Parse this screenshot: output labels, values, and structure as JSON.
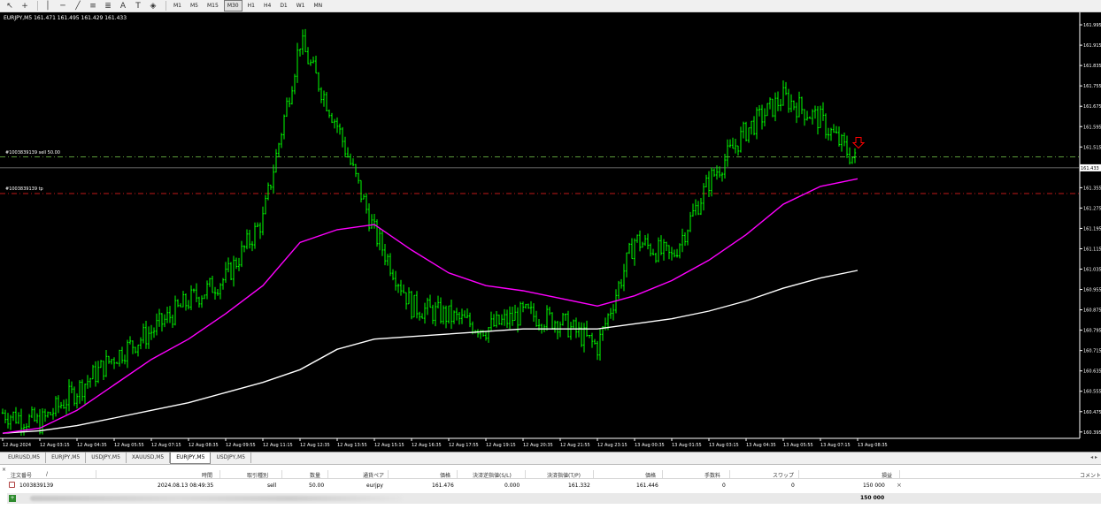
{
  "toolbar": {
    "tool_icons": [
      "cursor-icon",
      "crosshair-icon",
      "vertical-line-icon",
      "horizontal-line-icon",
      "trendline-icon",
      "channel-icon",
      "fibonacci-icon",
      "text-icon",
      "label-icon",
      "shapes-icon"
    ],
    "text_tool": "A",
    "timeframes": [
      "M1",
      "M5",
      "M15",
      "M30",
      "H1",
      "H4",
      "D1",
      "W1",
      "MN"
    ],
    "active_timeframe": "M30"
  },
  "chart": {
    "title": "EURJPY,M5  161.471 161.495 161.429 161.433",
    "background": "#000000",
    "candle_color": "#00ff00",
    "ma_fast_color": "#ff00ff",
    "ma_slow_color": "#ffffff",
    "sell_line_color": "#5a9a3a",
    "tp_line_color": "#c01818",
    "sell_line_label": "#1003839139 sell 50.00",
    "tp_line_label": "#1003839139 tp",
    "current_price_label": "161.433",
    "arrow_color": "#ff0000",
    "price_ticks": [
      "161.995",
      "161.915",
      "161.835",
      "161.755",
      "161.675",
      "161.595",
      "161.515",
      "161.435",
      "161.355",
      "161.275",
      "161.195",
      "161.115",
      "161.035",
      "160.955",
      "160.875",
      "160.795",
      "160.715",
      "160.635",
      "160.555",
      "160.475",
      "160.395"
    ],
    "time_ticks": [
      "12 Aug 2024",
      "12 Aug 03:15",
      "12 Aug 04:35",
      "12 Aug 05:55",
      "12 Aug 07:15",
      "12 Aug 08:35",
      "12 Aug 09:55",
      "12 Aug 11:15",
      "12 Aug 12:35",
      "12 Aug 13:55",
      "12 Aug 15:15",
      "12 Aug 16:35",
      "12 Aug 17:55",
      "12 Aug 19:15",
      "12 Aug 20:35",
      "12 Aug 21:55",
      "12 Aug 23:15",
      "13 Aug 00:35",
      "13 Aug 01:55",
      "13 Aug 03:15",
      "13 Aug 04:35",
      "13 Aug 05:55",
      "13 Aug 07:15",
      "13 Aug 08:35"
    ]
  },
  "chart_data": {
    "type": "line",
    "x": [
      "12 Aug 2024",
      "12 Aug 03:15",
      "12 Aug 04:35",
      "12 Aug 05:55",
      "12 Aug 07:15",
      "12 Aug 08:35",
      "12 Aug 09:55",
      "12 Aug 11:15",
      "12 Aug 12:35",
      "12 Aug 13:55",
      "12 Aug 15:15",
      "12 Aug 16:35",
      "12 Aug 17:55",
      "12 Aug 19:15",
      "12 Aug 20:35",
      "12 Aug 21:55",
      "12 Aug 23:15",
      "13 Aug 00:35",
      "13 Aug 01:55",
      "13 Aug 03:15",
      "13 Aug 04:35",
      "13 Aug 05:55",
      "13 Aug 07:15",
      "13 Aug 08:35"
    ],
    "series": [
      {
        "name": "EURJPY,M5",
        "values": [
          160.47,
          160.43,
          160.56,
          160.69,
          160.79,
          160.91,
          161.0,
          161.23,
          161.93,
          161.6,
          161.18,
          160.89,
          160.85,
          160.8,
          160.86,
          160.83,
          160.73,
          161.15,
          161.08,
          161.38,
          161.58,
          161.71,
          161.62,
          161.45
        ]
      },
      {
        "values": [
          160.39,
          160.41,
          160.48,
          160.58,
          160.68,
          160.76,
          160.86,
          160.97,
          161.14,
          161.19,
          161.21,
          161.11,
          161.02,
          160.97,
          160.95,
          160.92,
          160.89,
          160.93,
          160.99,
          161.07,
          161.17,
          161.29,
          161.36,
          161.39
        ]
      },
      {
        "values": [
          160.39,
          160.4,
          160.42,
          160.45,
          160.48,
          160.51,
          160.55,
          160.59,
          160.64,
          160.72,
          160.76,
          160.77,
          160.78,
          160.79,
          160.8,
          160.8,
          160.8,
          160.82,
          160.84,
          160.87,
          160.91,
          160.96,
          161.0,
          161.03
        ]
      }
    ],
    "hlines": [
      {
        "label": "#1003839139 sell 50.00",
        "value": 161.476
      },
      {
        "label": "#1003839139 tp",
        "value": 161.332
      },
      {
        "label": "161.433",
        "value": 161.433
      }
    ],
    "ylim": [
      160.37,
      162.03
    ],
    "grid": false
  },
  "symbol_tabs": {
    "tabs": [
      "EURUSD,M5",
      "EURJPY,M5",
      "USDJPY,M5",
      "XAUUSD,M5",
      "EURJPY,M5",
      "USDJPY,M5"
    ],
    "active_index": 4,
    "arrows": "◂ ▸"
  },
  "terminal": {
    "close_glyph": "×",
    "headers": {
      "order": "注文番号",
      "order_sort": "/",
      "time": "時間",
      "type": "取引種別",
      "volume": "数量",
      "symbol": "通貨ペア",
      "open_price": "価格",
      "sl": "決済逆指値(S/L)",
      "tp": "決済指値(T/P)",
      "price": "価格",
      "commission": "手数料",
      "swap": "スワップ",
      "profit": "損益",
      "comment": "コメント"
    },
    "order": {
      "order": "1003839139",
      "time": "2024.08.13 08:49:35",
      "type": "sell",
      "volume": "50.00",
      "symbol": "eurjpy",
      "open_price": "161.476",
      "sl": "0.000",
      "tp": "161.332",
      "price": "161.446",
      "commission": "0",
      "swap": "0",
      "profit": "150 000",
      "remove": "×"
    },
    "summary": {
      "profit": "150 000"
    }
  }
}
